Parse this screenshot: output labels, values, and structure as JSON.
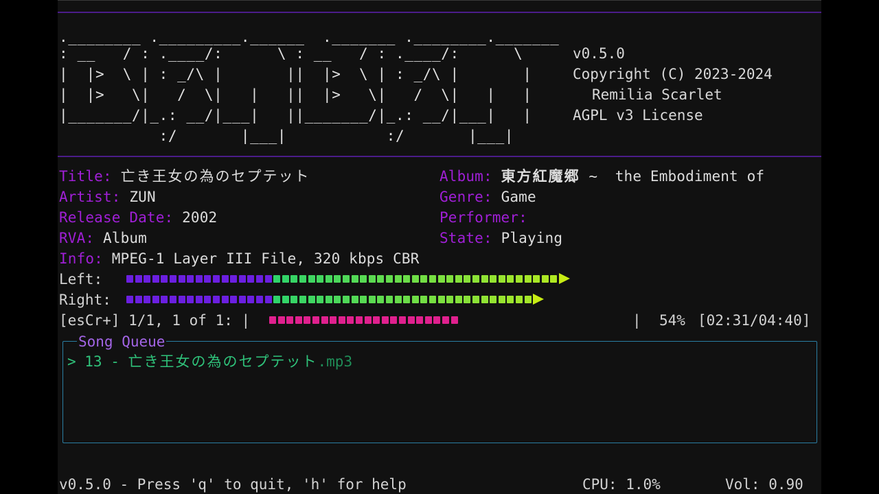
{
  "banner": {
    "ascii_lines": [
      ".________ ._________.______  ._______ .________._______",
      ": __   / : .____/:      \\ : __   / : .____/:      \\",
      "|  |>  \\ | : _/\\ |       ||  |>  \\ | : _/\\ |       |",
      "|  |>   \\|   /  \\|   |   ||  |>   \\|   /  \\|   |   |",
      "|_______/|_.: __/|___|   ||_______/|_.: __/|___|   |",
      "           :/       |___|           :/       |___|"
    ],
    "version": "v0.5.0",
    "copyright": "Copyright (C) 2023-2024",
    "author": "Remilia Scarlet",
    "license": "AGPL v3 License"
  },
  "track": {
    "title_label": "Title:",
    "title": "亡き王女の為のセプテット",
    "album_label": "Album:",
    "album_jp": "東方紅魔郷",
    "album_rest": " ~  the Embodiment of",
    "artist_label": "Artist:",
    "artist": "ZUN",
    "genre_label": "Genre:",
    "genre": "Game",
    "release_label": "Release Date:",
    "release": "2002",
    "performer_label": "Performer:",
    "performer": "",
    "rva_label": "RVA:",
    "rva": "Album",
    "state_label": "State:",
    "state": "Playing",
    "info_label": "Info:",
    "info": "MPEG-1 Layer III File, 320 kbps CBR"
  },
  "meters": {
    "left_label": "Left:",
    "left_level": 0.9,
    "right_label": "Right:",
    "right_level": 0.86
  },
  "status": {
    "prefix": "[esCr+] 1/1, 1 of 1: |",
    "end_bar": "|",
    "percent": "54%",
    "time": "[02:31/04:40]",
    "progress": 0.54
  },
  "queue": {
    "title": "Song Queue",
    "items": [
      {
        "marker": "> 13 - ",
        "name": "亡き王女の為のセプテット",
        "ext": ".mp3"
      }
    ]
  },
  "footer": {
    "help": "v0.5.0 - Press 'q' to quit, 'h' for help",
    "cpu": "CPU: 1.0%",
    "vol": "Vol: 0.90"
  },
  "colors": {
    "label": "#a01fd6",
    "meter_low": "#6b1fe0",
    "meter_mid": "#2fd36a",
    "meter_high": "#c8ec14",
    "progress": "#e0208e",
    "queue_border": "#2a7ea3",
    "queue_item": "#2fc27a"
  }
}
